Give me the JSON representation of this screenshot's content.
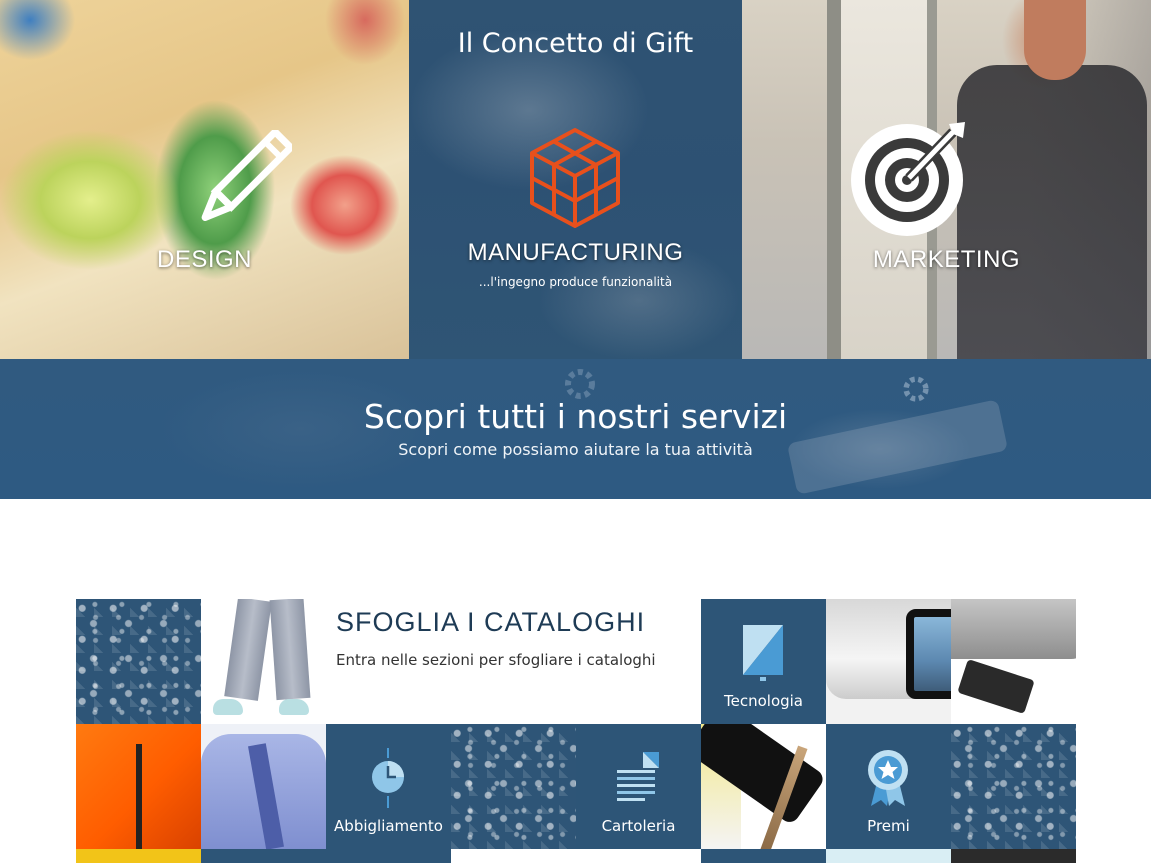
{
  "hero": {
    "title": "Il Concetto di Gift",
    "panels": [
      {
        "label": "DESIGN",
        "icon": "pencil-icon"
      },
      {
        "label": "MANUFACTURING",
        "sublabel": "...l'ingegno produce funzionalità",
        "icon": "cube-icon"
      },
      {
        "label": "MARKETING",
        "icon": "target-icon"
      }
    ]
  },
  "services_banner": {
    "title": "Scopri tutti i nostri servizi",
    "subtitle": "Scopri come possiamo aiutare la tua attività"
  },
  "catalog": {
    "title": "SFOGLIA I CATALOGHI",
    "subtitle": "Entra nelle sezioni per sfogliare i cataloghi",
    "categories": [
      {
        "label": "Tecnologia",
        "icon": "tablet-icon"
      },
      {
        "label": "Abbigliamento",
        "icon": "clock-icon"
      },
      {
        "label": "Cartoleria",
        "icon": "document-icon"
      },
      {
        "label": "Premi",
        "icon": "award-icon"
      }
    ]
  },
  "colors": {
    "brand_blue": "#2d5577",
    "manufacturing_orange": "#e8501c",
    "heading_navy": "#1e3b55"
  }
}
